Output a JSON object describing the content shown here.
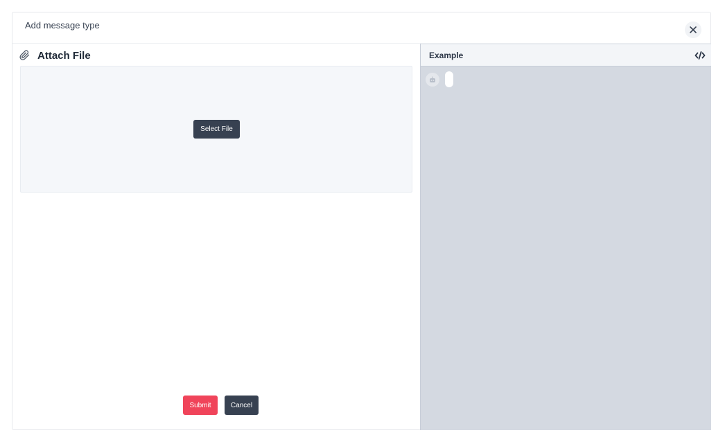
{
  "modal": {
    "title": "Add message type",
    "close_icon": "close-icon"
  },
  "attach": {
    "icon": "paperclip-icon",
    "title": "Attach File",
    "select_label": "Select File"
  },
  "footer": {
    "submit_label": "Submit",
    "cancel_label": "Cancel"
  },
  "example": {
    "title": "Example",
    "toggle_icon": "code-icon",
    "avatar_icon": "bot-icon"
  },
  "colors": {
    "primary": "#374151",
    "danger": "#f0445a",
    "preview_bg": "#d4d9e1"
  }
}
